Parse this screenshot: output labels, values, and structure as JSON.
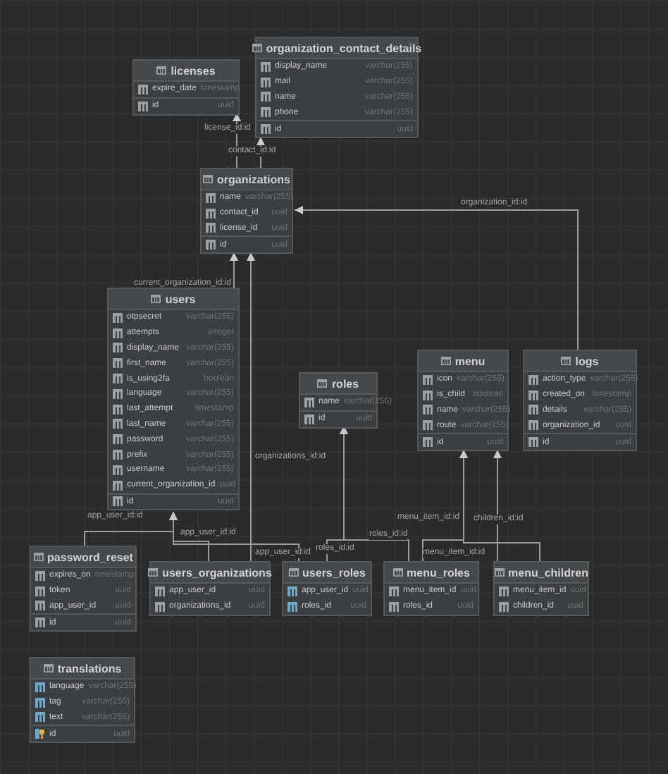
{
  "tables": [
    {
      "name": "licenses",
      "columns": [
        {
          "name": "expire_date",
          "type": "timestamp",
          "kind": "column"
        }
      ],
      "keys": [
        {
          "name": "id",
          "type": "uuid",
          "kind": "column"
        }
      ]
    },
    {
      "name": "organization_contact_details",
      "columns": [
        {
          "name": "display_name",
          "type": "varchar(255)",
          "kind": "column"
        },
        {
          "name": "mail",
          "type": "varchar(255)",
          "kind": "column"
        },
        {
          "name": "name",
          "type": "varchar(255)",
          "kind": "column"
        },
        {
          "name": "phone",
          "type": "varchar(255)",
          "kind": "column"
        }
      ],
      "keys": [
        {
          "name": "id",
          "type": "uuid",
          "kind": "column"
        }
      ]
    },
    {
      "name": "organizations",
      "columns": [
        {
          "name": "name",
          "type": "varchar(255)",
          "kind": "column"
        },
        {
          "name": "contact_id",
          "type": "uuid",
          "kind": "column"
        },
        {
          "name": "license_id",
          "type": "uuid",
          "kind": "column"
        }
      ],
      "keys": [
        {
          "name": "id",
          "type": "uuid",
          "kind": "column"
        }
      ]
    },
    {
      "name": "users",
      "columns": [
        {
          "name": "otpsecret",
          "type": "varchar(255)",
          "kind": "column"
        },
        {
          "name": "attempts",
          "type": "integer",
          "kind": "column"
        },
        {
          "name": "display_name",
          "type": "varchar(255)",
          "kind": "column"
        },
        {
          "name": "first_name",
          "type": "varchar(255)",
          "kind": "column"
        },
        {
          "name": "is_using2fa",
          "type": "boolean",
          "kind": "column"
        },
        {
          "name": "language",
          "type": "varchar(255)",
          "kind": "column"
        },
        {
          "name": "last_attempt",
          "type": "timestamp",
          "kind": "column"
        },
        {
          "name": "last_name",
          "type": "varchar(255)",
          "kind": "column"
        },
        {
          "name": "password",
          "type": "varchar(255)",
          "kind": "column"
        },
        {
          "name": "prefix",
          "type": "varchar(255)",
          "kind": "column"
        },
        {
          "name": "username",
          "type": "varchar(255)",
          "kind": "column"
        },
        {
          "name": "current_organization_id",
          "type": "uuid",
          "kind": "column"
        }
      ],
      "keys": [
        {
          "name": "id",
          "type": "uuid",
          "kind": "column"
        }
      ]
    },
    {
      "name": "roles",
      "columns": [
        {
          "name": "name",
          "type": "varchar(255)",
          "kind": "column"
        }
      ],
      "keys": [
        {
          "name": "id",
          "type": "uuid",
          "kind": "column"
        }
      ]
    },
    {
      "name": "menu",
      "columns": [
        {
          "name": "icon",
          "type": "varchar(255)",
          "kind": "column"
        },
        {
          "name": "is_child",
          "type": "boolean",
          "kind": "column"
        },
        {
          "name": "name",
          "type": "varchar(255)",
          "kind": "column"
        },
        {
          "name": "route",
          "type": "varchar(255)",
          "kind": "column"
        }
      ],
      "keys": [
        {
          "name": "id",
          "type": "uuid",
          "kind": "column"
        }
      ]
    },
    {
      "name": "logs",
      "columns": [
        {
          "name": "action_type",
          "type": "varchar(255)",
          "kind": "column"
        },
        {
          "name": "created_on",
          "type": "timestamp",
          "kind": "column"
        },
        {
          "name": "details",
          "type": "varchar(255)",
          "kind": "column"
        },
        {
          "name": "organization_id",
          "type": "uuid",
          "kind": "column"
        }
      ],
      "keys": [
        {
          "name": "id",
          "type": "uuid",
          "kind": "column"
        }
      ]
    },
    {
      "name": "password_reset",
      "columns": [
        {
          "name": "expires_on",
          "type": "timestamp",
          "kind": "column"
        },
        {
          "name": "token",
          "type": "uuid",
          "kind": "column"
        },
        {
          "name": "app_user_id",
          "type": "uuid",
          "kind": "column"
        }
      ],
      "keys": [
        {
          "name": "id",
          "type": "uuid",
          "kind": "column"
        }
      ]
    },
    {
      "name": "users_organizations",
      "columns": [
        {
          "name": "app_user_id",
          "type": "uuid",
          "kind": "column"
        },
        {
          "name": "organizations_id",
          "type": "uuid",
          "kind": "column"
        }
      ]
    },
    {
      "name": "users_roles",
      "columns": [
        {
          "name": "app_user_id",
          "type": "uuid",
          "kind": "indexed"
        },
        {
          "name": "roles_id",
          "type": "uuid",
          "kind": "indexed"
        }
      ]
    },
    {
      "name": "menu_roles",
      "columns": [
        {
          "name": "menu_item_id",
          "type": "uuid",
          "kind": "column"
        },
        {
          "name": "roles_id",
          "type": "uuid",
          "kind": "column"
        }
      ]
    },
    {
      "name": "menu_children",
      "columns": [
        {
          "name": "menu_item_id",
          "type": "uuid",
          "kind": "column"
        },
        {
          "name": "children_id",
          "type": "uuid",
          "kind": "column"
        }
      ]
    },
    {
      "name": "translations",
      "columns": [
        {
          "name": "language",
          "type": "varchar(255)",
          "kind": "indexed"
        },
        {
          "name": "tag",
          "type": "varchar(255)",
          "kind": "indexed"
        },
        {
          "name": "text",
          "type": "varchar(255)",
          "kind": "indexed"
        }
      ],
      "keys": [
        {
          "name": "id",
          "type": "uuid",
          "kind": "key"
        }
      ]
    }
  ],
  "relations": [
    {
      "label": "license_id:id"
    },
    {
      "label": "contact_id:id"
    },
    {
      "label": "organization_id:id"
    },
    {
      "label": "current_organization_id:id"
    },
    {
      "label": "organizations_id:id"
    },
    {
      "label": "app_user_id:id"
    },
    {
      "label": "app_user_id:id"
    },
    {
      "label": "app_user_id:id"
    },
    {
      "label": "roles_id:id"
    },
    {
      "label": "roles_id:id"
    },
    {
      "label": "menu_item_id:id"
    },
    {
      "label": "menu_item_id:id"
    },
    {
      "label": "children_id:id"
    }
  ]
}
